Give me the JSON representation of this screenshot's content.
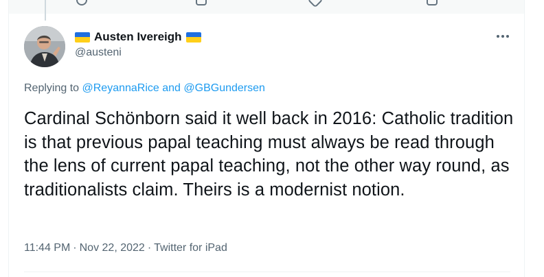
{
  "tweet": {
    "author": {
      "display_name": "Austen Ivereigh",
      "handle": "@austeni"
    },
    "replying_prefix": "Replying to",
    "reply_to_1": "@ReyannaRice",
    "reply_to_and": "and",
    "reply_to_2": "@GBGundersen",
    "text": "Cardinal Schönborn said it well back in 2016: Catholic tradition is that previous papal teaching must always be read through the lens of current papal teaching, not the other way round, as traditionalists claim. Theirs is a modernist notion.",
    "time": "11:44 PM",
    "separator": "·",
    "date": "Nov 22, 2022",
    "source": "Twitter for iPad"
  },
  "icons": {
    "flag": "ukraine-flag-icon",
    "more": "more-options-icon"
  },
  "colors": {
    "link": "#1d9bf0",
    "secondary_text": "#536471",
    "primary_text": "#0f1419",
    "flag_blue": "#1f6fe0",
    "flag_yellow": "#ffcf1a"
  }
}
